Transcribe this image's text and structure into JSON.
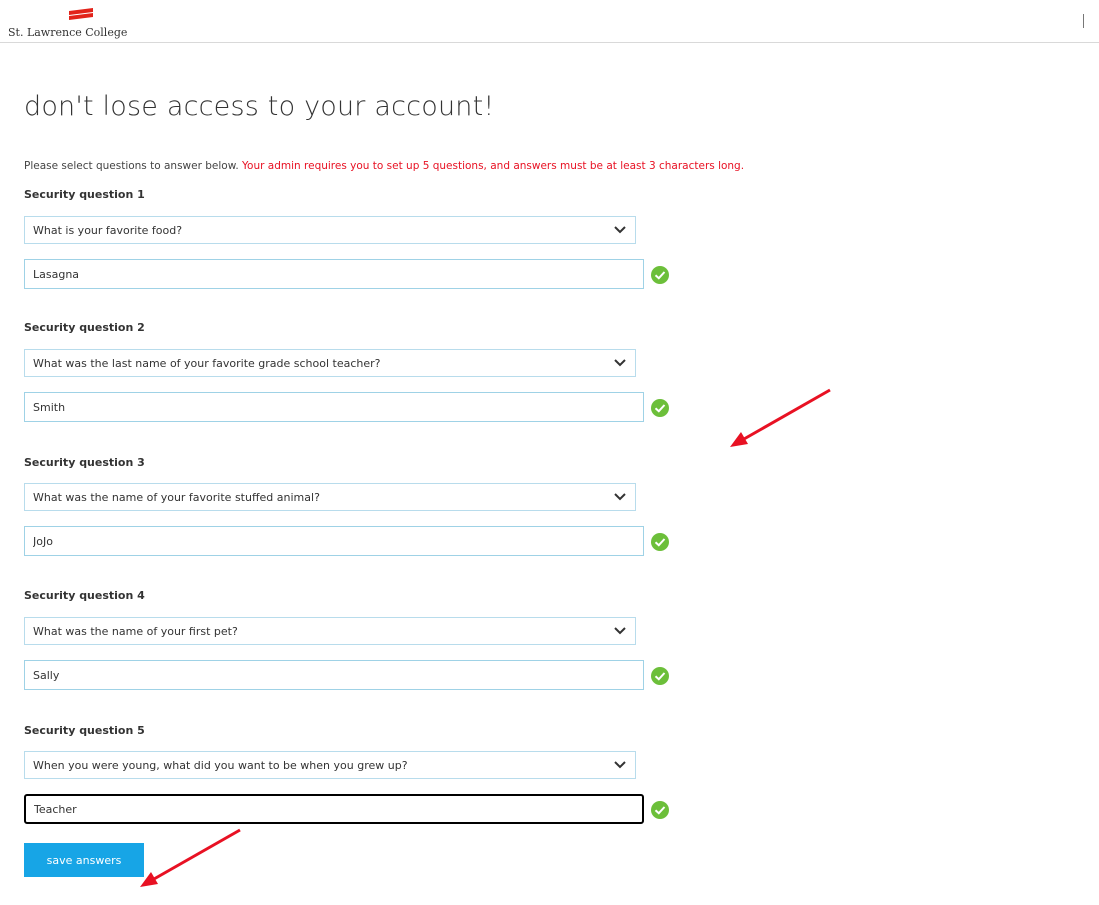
{
  "header": {
    "logo_text": "St. Lawrence College"
  },
  "page": {
    "title": "don't lose access to your account!",
    "intro": "Please select questions to answer below.",
    "requirement": "Your admin requires you to set up 5 questions, and answers must be at least 3 characters long."
  },
  "questions": [
    {
      "label": "Security question 1",
      "question": "What is your favorite food?",
      "answer": "Lasagna"
    },
    {
      "label": "Security question 2",
      "question": "What was the last name of your favorite grade school teacher?",
      "answer": "Smith"
    },
    {
      "label": "Security question 3",
      "question": "What was the name of your favorite stuffed animal?",
      "answer": "JoJo"
    },
    {
      "label": "Security question 4",
      "question": "What was the name of your first pet?",
      "answer": "Sally"
    },
    {
      "label": "Security question 5",
      "question": "When you were young, what did you want to be when you grew up?",
      "answer": "Teacher"
    }
  ],
  "actions": {
    "save_label": "save answers"
  },
  "icons": {
    "logo": "college-logo-icon",
    "dropdown": "chevron-down-icon",
    "valid": "check-circle-icon",
    "annotation": "red-arrow-icon"
  },
  "colors": {
    "accent": "#17a5e6",
    "requirement": "#e81123",
    "valid": "#6cbf3a",
    "annotation": "#e81123"
  }
}
